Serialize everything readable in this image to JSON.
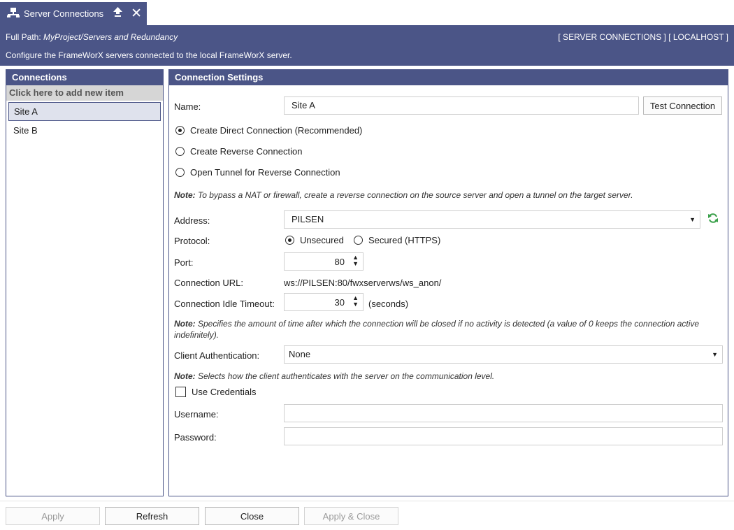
{
  "tab": {
    "title": "Server Connections",
    "icon": "server-network-icon",
    "pin_icon": "pin-icon",
    "close_icon": "close-icon"
  },
  "header": {
    "path_label": "Full Path:",
    "path_value": "MyProject/Servers and Redundancy",
    "context": "[ SERVER CONNECTIONS ] [ LOCALHOST ]",
    "description": "Configure the FrameWorX servers connected to the local FrameWorX server."
  },
  "connections": {
    "title": "Connections",
    "add_item": "Click here to add new item",
    "items": [
      {
        "label": "Site A",
        "selected": true
      },
      {
        "label": "Site B",
        "selected": false
      }
    ]
  },
  "settings": {
    "title": "Connection Settings",
    "name_label": "Name:",
    "name_value": "Site A",
    "test_button": "Test Connection",
    "mode_options": [
      {
        "label": "Create Direct Connection (Recommended)",
        "checked": true
      },
      {
        "label": "Create Reverse Connection",
        "checked": false
      },
      {
        "label": "Open Tunnel for Reverse Connection",
        "checked": false
      }
    ],
    "note1_bold": "Note:",
    "note1_text": " To bypass a NAT or firewall, create a reverse connection on the source server and open a tunnel on the target server.",
    "address_label": "Address:",
    "address_value": "PILSEN",
    "protocol_label": "Protocol:",
    "protocol_unsecured": "Unsecured",
    "protocol_secured": "Secured (HTTPS)",
    "port_label": "Port:",
    "port_value": "80",
    "url_label": "Connection URL:",
    "url_value": "ws://PILSEN:80/fwxserverws/ws_anon/",
    "timeout_label": "Connection Idle Timeout:",
    "timeout_value": "30",
    "timeout_unit": "(seconds)",
    "note2_bold": "Note:",
    "note2_text": " Specifies the amount of time after which the connection will be closed if no activity is detected (a value of 0 keeps the connection active indefinitely).",
    "auth_label": "Client Authentication:",
    "auth_value": "None",
    "note3_bold": "Note:",
    "note3_text": " Selects how the client authenticates with the server on the communication level.",
    "use_credentials": "Use Credentials",
    "username_label": "Username:",
    "username_value": "",
    "password_label": "Password:",
    "password_value": ""
  },
  "footer": {
    "apply": "Apply",
    "refresh": "Refresh",
    "close": "Close",
    "apply_close": "Apply & Close"
  },
  "colors": {
    "accent": "#4b5587",
    "selection": "#dfe2ed",
    "refresh_icon": "#3aa04a"
  }
}
